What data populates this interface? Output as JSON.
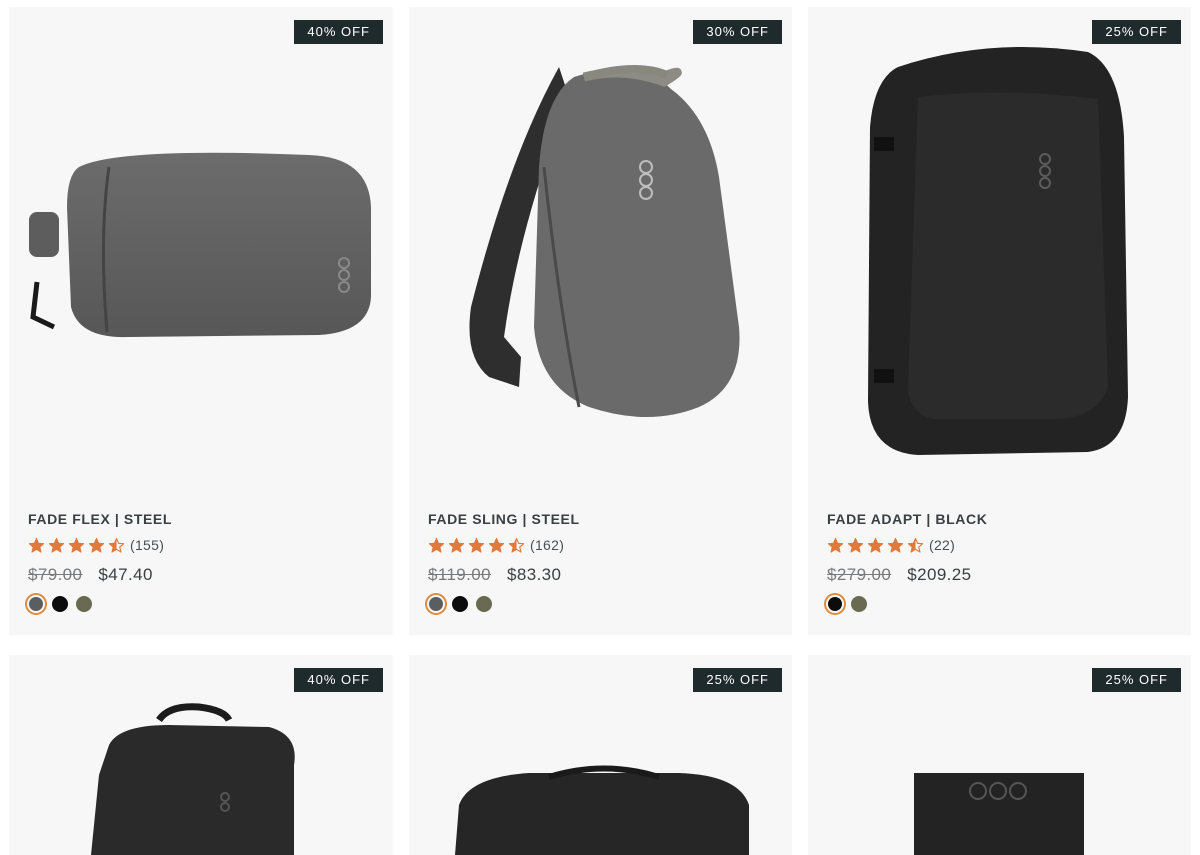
{
  "colors": {
    "accent_star": "#e0793a",
    "badge_bg": "#1f2a2c",
    "card_bg": "#f7f7f7",
    "swatch_selected_ring": "#e08a3c"
  },
  "products": [
    {
      "badge": "40% OFF",
      "image_icon": "sling-bag-steel-image",
      "name": "FADE FLEX | STEEL",
      "rating": 4.5,
      "rating_count": "(155)",
      "price_original": "$79.00",
      "price_sale": "$47.40",
      "swatches": [
        {
          "color": "#5b5e60",
          "selected": true
        },
        {
          "color": "#0c0c0c",
          "selected": false
        },
        {
          "color": "#6a6a52",
          "selected": false
        }
      ]
    },
    {
      "badge": "30% OFF",
      "image_icon": "sling-backpack-steel-image",
      "name": "FADE SLING | STEEL",
      "rating": 4.5,
      "rating_count": "(162)",
      "price_original": "$119.00",
      "price_sale": "$83.30",
      "swatches": [
        {
          "color": "#5b5e60",
          "selected": true
        },
        {
          "color": "#0c0c0c",
          "selected": false
        },
        {
          "color": "#6a6a52",
          "selected": false
        }
      ]
    },
    {
      "badge": "25% OFF",
      "image_icon": "backpack-black-image",
      "name": "FADE ADAPT | BLACK",
      "rating": 4.5,
      "rating_count": "(22)",
      "price_original": "$279.00",
      "price_sale": "$209.25",
      "swatches": [
        {
          "color": "#0c0c0c",
          "selected": true
        },
        {
          "color": "#6a6a52",
          "selected": false
        }
      ]
    },
    {
      "badge": "40% OFF",
      "image_icon": "backpack-image"
    },
    {
      "badge": "25% OFF",
      "image_icon": "duffel-bag-image"
    },
    {
      "badge": "25% OFF",
      "image_icon": "pouch-image"
    }
  ]
}
